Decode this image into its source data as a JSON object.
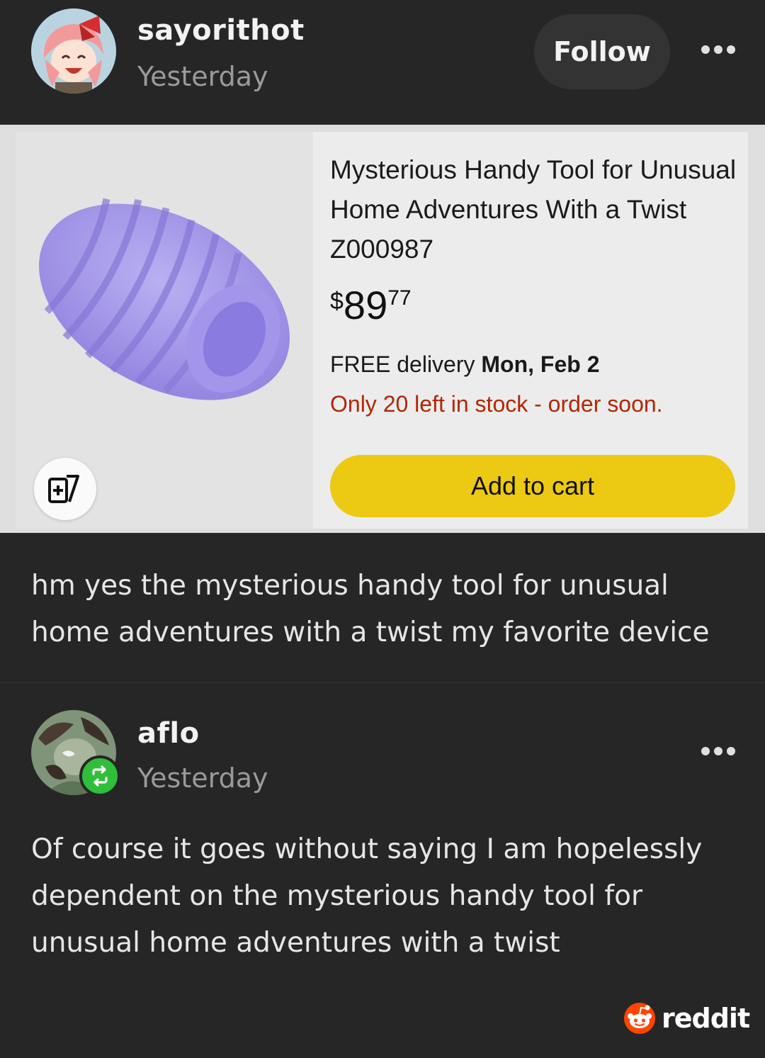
{
  "post": {
    "username": "sayorithot",
    "timestamp": "Yesterday",
    "follow_label": "Follow",
    "caption": "hm yes the mysterious handy tool for unusual home adventures with a twist my favorite device"
  },
  "product": {
    "title": "Mysterious Handy Tool for Unusual Home Adventures With a Twist Z000987",
    "price_currency": "$",
    "price_whole": "89",
    "price_fraction": "77",
    "delivery_prefix": "FREE delivery",
    "delivery_date": "Mon, Feb 2",
    "stock_notice": "Only 20 left in stock - order soon.",
    "cart_label": "Add to cart",
    "image_icon": "purple-product-image",
    "compare_icon": "compare-cards-icon"
  },
  "reblog": {
    "username": "aflo",
    "timestamp": "Yesterday",
    "text": "Of course it goes without saying I am hopelessly dependent on the mysterious handy tool for unusual home adventures with a twist"
  },
  "watermark": {
    "label": "reddit",
    "icon": "reddit-snoo-icon"
  },
  "colors": {
    "background": "#262626",
    "cart_button": "#ecc913",
    "stock_text": "#b12704",
    "reblog_badge": "#2fbf3a",
    "reddit_orange": "#ff4500"
  }
}
